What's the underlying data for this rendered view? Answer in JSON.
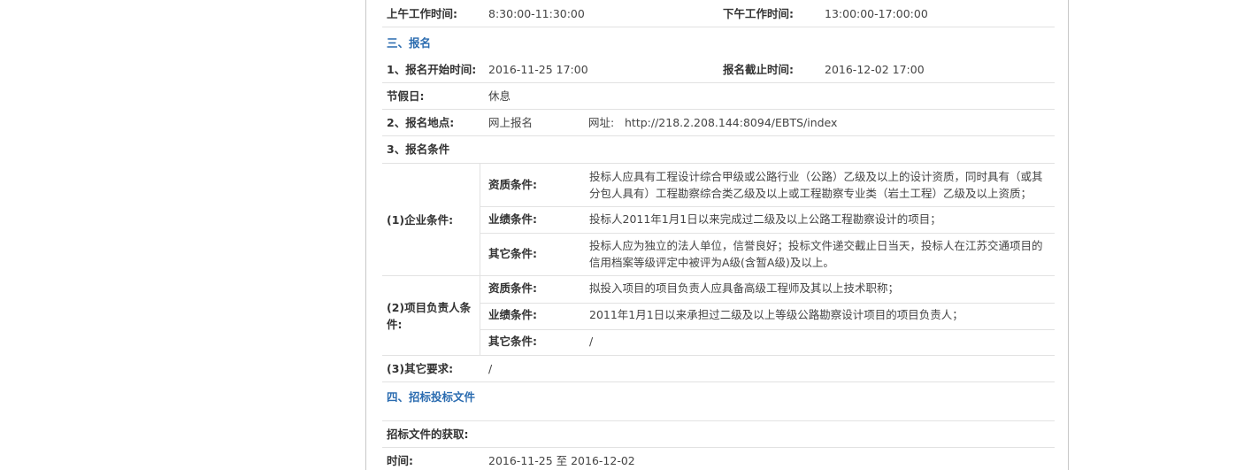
{
  "work_time": {
    "morning_label": "上午工作时间:",
    "morning_value": "8:30:00-11:30:00",
    "afternoon_label": "下午工作时间:",
    "afternoon_value": "13:00:00-17:00:00"
  },
  "section3": {
    "heading": "三、报名",
    "start_label": "1、报名开始时间:",
    "start_value": "2016-11-25 17:00",
    "deadline_label": "报名截止时间:",
    "deadline_value": "2016-12-02 17:00",
    "holiday_label": "节假日:",
    "holiday_value": "休息",
    "place_label": "2、报名地点:",
    "place_value": "网上报名",
    "url_label": "网址:",
    "url_value": "http://218.2.208.144:8094/EBTS/index",
    "conditions_label": "3、报名条件"
  },
  "enterprise": {
    "label": "(1)企业条件:",
    "qual_label": "资质条件:",
    "qual_value": "投标人应具有工程设计综合甲级或公路行业（公路）乙级及以上的设计资质，同时具有（或其分包人具有）工程勘察综合类乙级及以上或工程勘察专业类（岩土工程）乙级及以上资质；",
    "perf_label": "业绩条件:",
    "perf_value": "投标人2011年1月1日以来完成过二级及以上公路工程勘察设计的项目；",
    "other_label": "其它条件:",
    "other_value": "投标人应为独立的法人单位，信誉良好；投标文件递交截止日当天，投标人在江苏交通项目的信用档案等级评定中被评为A级(含暂A级)及以上。"
  },
  "manager": {
    "label": "(2)项目负责人条件:",
    "qual_label": "资质条件:",
    "qual_value": "拟投入项目的项目负责人应具备高级工程师及其以上技术职称；",
    "perf_label": "业绩条件:",
    "perf_value": "2011年1月1日以来承担过二级及以上等级公路勘察设计项目的项目负责人；",
    "other_label": "其它条件:",
    "other_value": "/"
  },
  "other_req": {
    "label": "(3)其它要求:",
    "value": "/"
  },
  "section4": {
    "heading": "四、招标投标文件",
    "obtain_label": "招标文件的获取:",
    "time_label": "时间:",
    "time_value": "2016-11-25 至 2016-12-02"
  }
}
